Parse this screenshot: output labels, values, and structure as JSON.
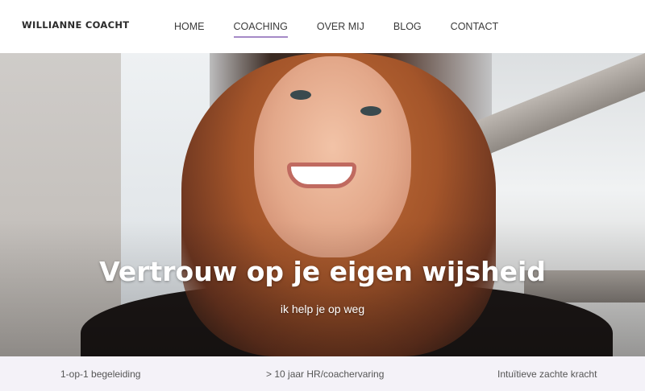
{
  "header": {
    "logo": "WILLIANNE COACHT",
    "nav": [
      {
        "label": "HOME",
        "active": false
      },
      {
        "label": "COACHING",
        "active": true
      },
      {
        "label": "OVER MIJ",
        "active": false
      },
      {
        "label": "BLOG",
        "active": false
      },
      {
        "label": "CONTACT",
        "active": false
      }
    ],
    "accent_color": "#a58ac7"
  },
  "hero": {
    "title": "Vertrouw op je eigen wijsheid",
    "subtitle": "ik help je op weg"
  },
  "features": {
    "items": [
      "1-op-1 begeleiding",
      "> 10 jaar HR/coachervaring",
      "Intuïtieve zachte kracht"
    ],
    "background_color": "#f4f2f8"
  }
}
